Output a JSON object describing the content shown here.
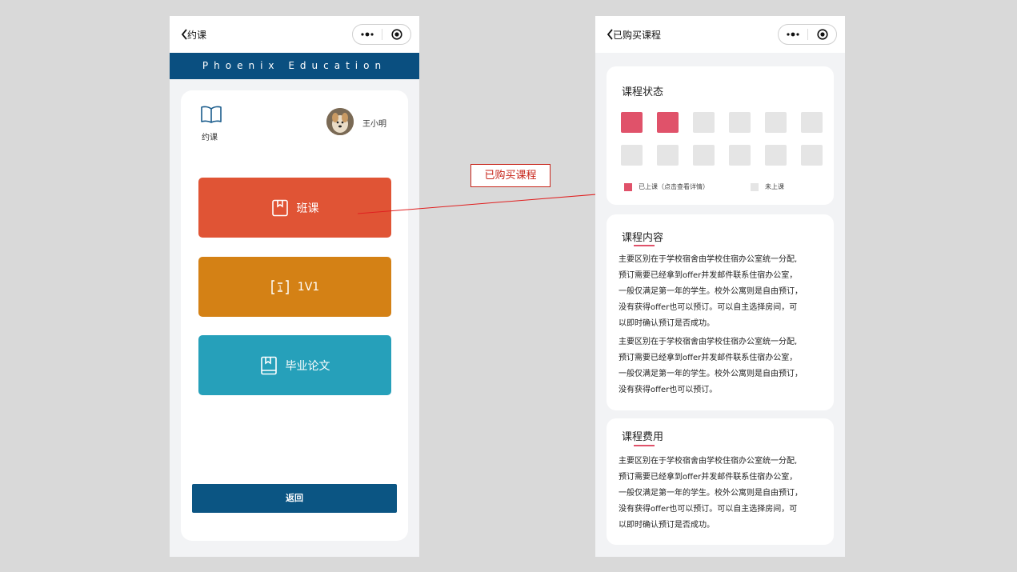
{
  "phone1": {
    "nav_title": "约课",
    "banner": "Phoenix Education",
    "book_label": "约课",
    "user_name": "王小明",
    "buttons": [
      {
        "label": "班课",
        "color": "#e05435",
        "icon": "bookmark-icon"
      },
      {
        "label": "1V1",
        "color": "#d48115",
        "icon": "one-on-one-icon"
      },
      {
        "label": "毕业论文",
        "color": "#26a0ba",
        "icon": "book-icon"
      }
    ],
    "back_label": "返回"
  },
  "annotation": {
    "label": "已购买课程",
    "color": "#c7251a"
  },
  "phone2": {
    "nav_title": "已购买课程",
    "status": {
      "title": "课程状态",
      "attended_count": 2,
      "total_count": 12,
      "attended_color": "#e0526a",
      "pending_color": "#e5e5e5",
      "legend_attended": "已上课（点击查看详情）",
      "legend_pending": "未上课"
    },
    "content": {
      "title": "课程内容",
      "para1_lines": [
        "主要区别在于学校宿舍由学校住宿办公室统一分配,",
        "预订需要已经拿到offer并发邮件联系住宿办公室，",
        "一般仅满足第一年的学生。校外公寓则是自由预订，",
        "没有获得offer也可以预订。可以自主选择房间，可",
        "以即时确认预订是否成功。"
      ],
      "para2_lines": [
        "主要区别在于学校宿舍由学校住宿办公室统一分配,",
        "预订需要已经拿到offer并发邮件联系住宿办公室，",
        "一般仅满足第一年的学生。校外公寓则是自由预订，",
        "没有获得offer也可以预订。"
      ]
    },
    "fee": {
      "title": "课程费用",
      "lines": [
        "主要区别在于学校宿舍由学校住宿办公室统一分配,",
        "预订需要已经拿到offer并发邮件联系住宿办公室，",
        "一般仅满足第一年的学生。校外公寓则是自由预订，",
        "没有获得offer也可以预订。可以自主选择房间，可",
        "以即时确认预订是否成功。"
      ]
    }
  }
}
